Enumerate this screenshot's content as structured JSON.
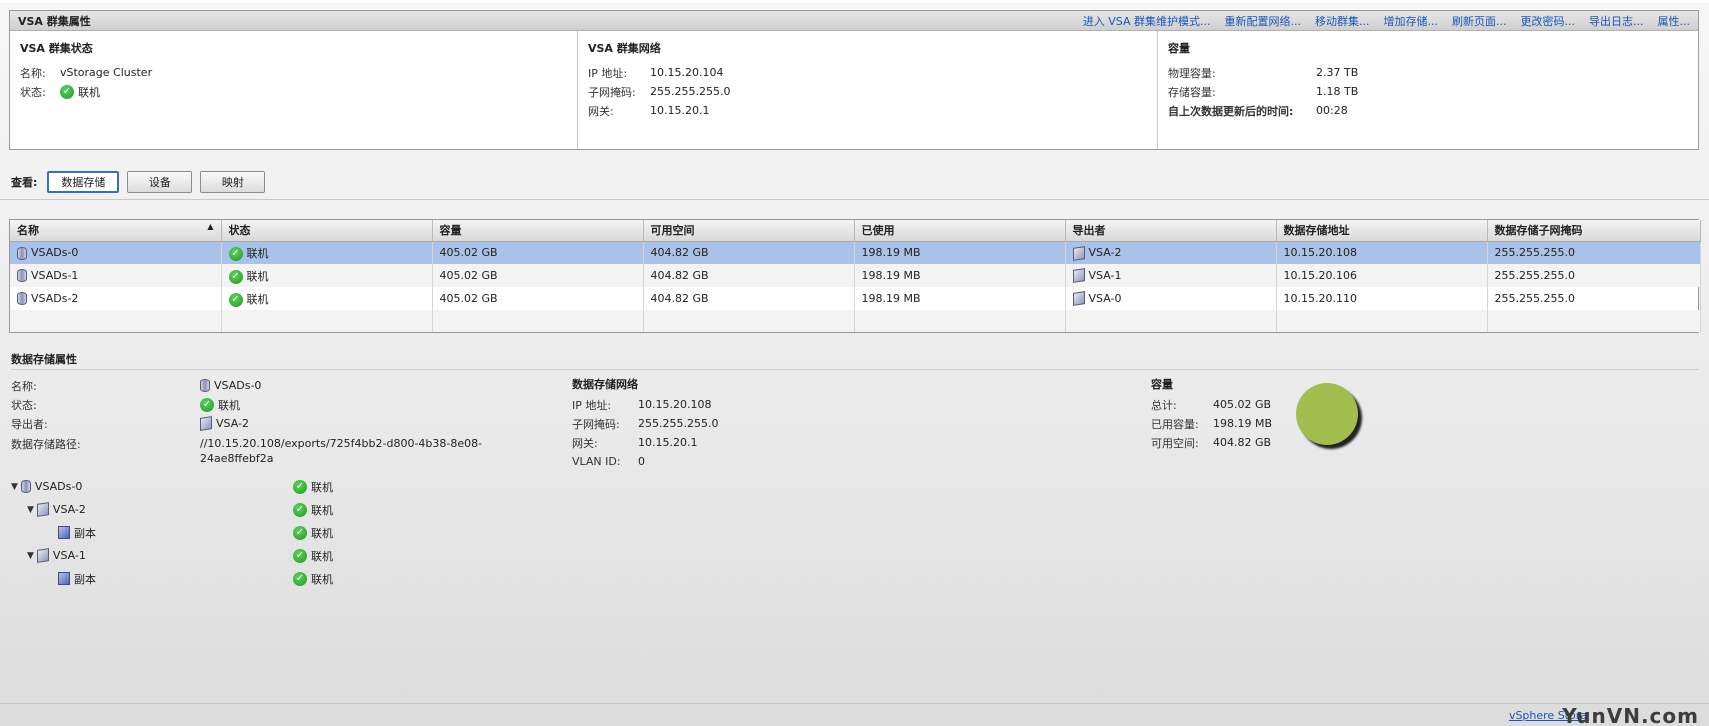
{
  "cluster": {
    "title": "VSA 群集属性",
    "actions": [
      "进入 VSA 群集维护模式...",
      "重新配置网络...",
      "移动群集...",
      "增加存储...",
      "刷新页面...",
      "更改密码...",
      "导出日志...",
      "属性..."
    ],
    "status": {
      "title": "VSA 群集状态",
      "name_label": "名称:",
      "name_value": "vStorage Cluster",
      "state_label": "状态:",
      "state_value": "联机"
    },
    "network": {
      "title": "VSA 群集网络",
      "ip_label": "IP 地址:",
      "ip_value": "10.15.20.104",
      "mask_label": "子网掩码:",
      "mask_value": "255.255.255.0",
      "gateway_label": "网关:",
      "gateway_value": "10.15.20.1"
    },
    "capacity": {
      "title": "容量",
      "physical_label": "物理容量:",
      "physical_value": "2.37 TB",
      "storage_label": "存储容量:",
      "storage_value": "1.18 TB",
      "updated_label": "自上次数据更新后的时间:",
      "updated_value": "00:28"
    }
  },
  "view": {
    "label": "查看:",
    "buttons": [
      "数据存储",
      "设备",
      "映射"
    ]
  },
  "table": {
    "columns": [
      "名称",
      "状态",
      "容量",
      "可用空间",
      "已使用",
      "导出者",
      "数据存储地址",
      "数据存储子网掩码"
    ],
    "rows": [
      {
        "name": "VSADs-0",
        "status": "联机",
        "capacity": "405.02 GB",
        "free": "404.82 GB",
        "used": "198.19 MB",
        "exporter": "VSA-2",
        "address": "10.15.20.108",
        "mask": "255.255.255.0"
      },
      {
        "name": "VSADs-1",
        "status": "联机",
        "capacity": "405.02 GB",
        "free": "404.82 GB",
        "used": "198.19 MB",
        "exporter": "VSA-1",
        "address": "10.15.20.106",
        "mask": "255.255.255.0"
      },
      {
        "name": "VSADs-2",
        "status": "联机",
        "capacity": "405.02 GB",
        "free": "404.82 GB",
        "used": "198.19 MB",
        "exporter": "VSA-0",
        "address": "10.15.20.110",
        "mask": "255.255.255.0"
      }
    ]
  },
  "props": {
    "title": "数据存储属性",
    "name_label": "名称:",
    "name_value": "VSADs-0",
    "state_label": "状态:",
    "state_value": "联机",
    "exporter_label": "导出者:",
    "exporter_value": "VSA-2",
    "path_label": "数据存储路径:",
    "path_value": "//10.15.20.108/exports/725f4bb2-d800-4b38-8e08-24ae8ffebf2a",
    "network": {
      "title": "数据存储网络",
      "ip_label": "IP 地址:",
      "ip_value": "10.15.20.108",
      "mask_label": "子网掩码:",
      "mask_value": "255.255.255.0",
      "gateway_label": "网关:",
      "gateway_value": "10.15.20.1",
      "vlan_label": "VLAN ID:",
      "vlan_value": "0"
    },
    "capacity": {
      "title": "容量",
      "total_label": "总计:",
      "total_value": "405.02 GB",
      "used_label": "已用容量:",
      "used_value": "198.19 MB",
      "free_label": "可用空间:",
      "free_value": "404.82 GB"
    },
    "pie_colors": {
      "free": "#a3bd4f"
    }
  },
  "tree": [
    {
      "label": "VSADs-0",
      "status": "联机"
    },
    {
      "label": "VSA-2",
      "status": "联机"
    },
    {
      "label": "副本",
      "status": "联机"
    },
    {
      "label": "VSA-1",
      "status": "联机"
    },
    {
      "label": "副本",
      "status": "联机"
    }
  ],
  "footer": {
    "link": "vSphere Stora",
    "watermark": "YunVN.com"
  }
}
